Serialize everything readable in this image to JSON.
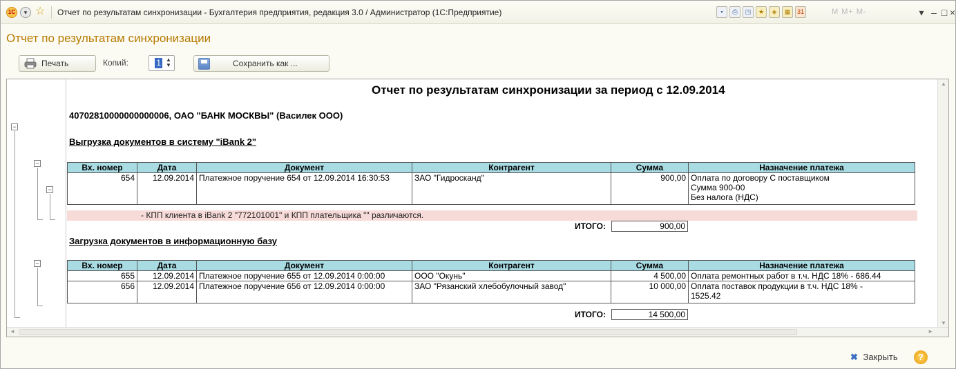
{
  "window": {
    "title": "Отчет по результатам синхронизации - Бухгалтерия предприятия, редакция 3.0 / Администратор  (1С:Предприятие)",
    "memory_buttons": "M  M+  M-"
  },
  "form": {
    "title": "Отчет по результатам синхронизации"
  },
  "toolbar": {
    "print_label": "Печать",
    "copies_label": "Копий:",
    "copies_value": "1",
    "save_as_label": "Сохранить как ..."
  },
  "report": {
    "title": "Отчет по результатам синхронизации за период с 12.09.2014",
    "account": "40702810000000000006, ОАО \"БАНК МОСКВЫ\" (Василек ООО)",
    "columns": [
      "Вх. номер",
      "Дата",
      "Документ",
      "Контрагент",
      "Сумма",
      "Назначение платежа"
    ],
    "export": {
      "heading": "Выгрузка документов в систему \"iBank 2\"",
      "rows": [
        {
          "num": "654",
          "date": "12.09.2014",
          "doc": "Платежное поручение 654 от 12.09.2014 16:30:53",
          "counterparty": "ЗАО \"Гидросканд\"",
          "sum": "900,00",
          "purpose": [
            "Оплата по договору С поставщиком",
            "Сумма 900-00",
            "Без налога (НДС)"
          ]
        }
      ],
      "warning": "-  КПП клиента в iBank 2 \"772101001\" и КПП плательщика \"\" различаются.",
      "total_label": "ИТОГО:",
      "total": "900,00"
    },
    "import": {
      "heading": "Загрузка документов в информационную базу",
      "rows": [
        {
          "num": "655",
          "date": "12.09.2014",
          "doc": "Платежное поручение 655 от 12.09.2014 0:00:00",
          "counterparty": "ООО \"Окунь\"",
          "sum": "4 500,00",
          "purpose": [
            "Оплата ремонтных работ в т.ч. НДС 18% - 686.44"
          ]
        },
        {
          "num": "656",
          "date": "12.09.2014",
          "doc": "Платежное поручение 656 от 12.09.2014 0:00:00",
          "counterparty": "ЗАО \"Рязанский хлебобулочный завод\"",
          "sum": "10 000,00",
          "purpose": [
            "Оплата поставок продукции в т.ч. НДС 18% -",
            "1525.42"
          ]
        }
      ],
      "total_label": "ИТОГО:",
      "total": "14 500,00"
    }
  },
  "footer": {
    "close_label": "Закрыть",
    "help_label": "?"
  }
}
